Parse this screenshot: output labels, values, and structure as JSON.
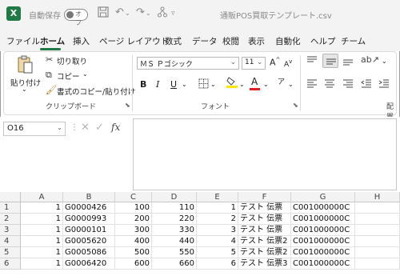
{
  "titlebar": {
    "autosave_label": "自動保存",
    "autosave_state": "オフ",
    "filename": "通販POS買取テンプレート.csv",
    "undo_icon": "undo-icon",
    "redo_icon": "redo-icon"
  },
  "tabs": [
    "ファイル",
    "ホーム",
    "挿入",
    "ページ レイアウト",
    "数式",
    "データ",
    "校閲",
    "表示",
    "自動化",
    "ヘルプ",
    "チーム"
  ],
  "active_tab": "ホーム",
  "ribbon": {
    "clipboard": {
      "paste_label": "貼り付け",
      "cut_label": "切り取り",
      "copy_label": "コピー",
      "format_painter_label": "書式のコピー/貼り付け",
      "group_label": "クリップボード"
    },
    "font": {
      "font_name": "ＭＳ Ｐゴシック",
      "font_size": "11",
      "grow_label": "A",
      "shrink_label": "A",
      "bold": "B",
      "italic": "I",
      "underline": "U",
      "font_color_label": "A",
      "phonetic_label": "ア",
      "group_label": "フォント",
      "highlight_color": "#ffe600",
      "font_color": "#e0201f"
    },
    "alignment": {
      "group_label": "配置"
    }
  },
  "formula_bar": {
    "name_box": "O16",
    "fx_label": "fx",
    "formula": ""
  },
  "grid": {
    "columns": [
      "A",
      "B",
      "C",
      "D",
      "E",
      "F",
      "G",
      "H"
    ],
    "rows": [
      {
        "num": "1",
        "A": "1",
        "B": "G0000426",
        "C": "100",
        "D": "110",
        "E": "1",
        "F": "テスト 伝票",
        "G": "C001000000C"
      },
      {
        "num": "2",
        "A": "1",
        "B": "G0000993",
        "C": "200",
        "D": "220",
        "E": "2",
        "F": "テスト 伝票",
        "G": "C001000000C"
      },
      {
        "num": "3",
        "A": "1",
        "B": "G0000101",
        "C": "300",
        "D": "330",
        "E": "3",
        "F": "テスト 伝票",
        "G": "C001000000C"
      },
      {
        "num": "4",
        "A": "1",
        "B": "G0005620",
        "C": "400",
        "D": "440",
        "E": "4",
        "F": "テスト 伝票2",
        "G": "C001000000C"
      },
      {
        "num": "5",
        "A": "1",
        "B": "G0005086",
        "C": "500",
        "D": "550",
        "E": "5",
        "F": "テスト 伝票2",
        "G": "C001000000C"
      },
      {
        "num": "6",
        "A": "1",
        "B": "G0006420",
        "C": "600",
        "D": "660",
        "E": "6",
        "F": "テスト 伝票3",
        "G": "C001000000C"
      }
    ]
  },
  "colors": {
    "accent": "#1f7a45"
  }
}
